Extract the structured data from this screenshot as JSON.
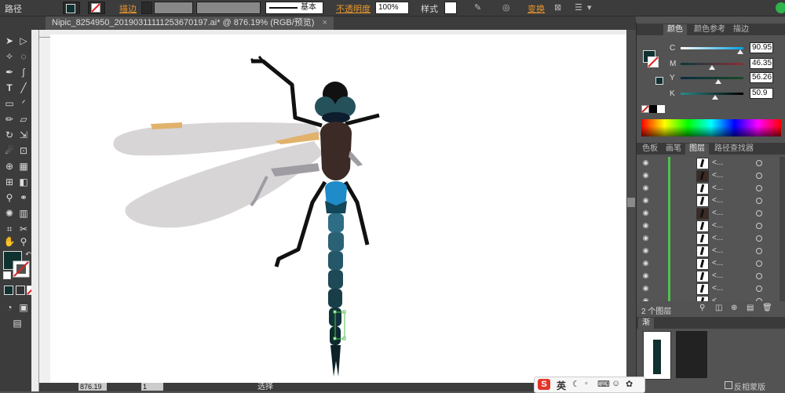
{
  "control_bar": {
    "object_type": "路径",
    "stroke_label": "描边",
    "brush_label": "基本",
    "opacity_label": "不透明度",
    "opacity_value": "100%",
    "style_label": "样式",
    "transform_label": "变换"
  },
  "document": {
    "tab_title": "Nipic_8254950_20190311111253670197.ai* @ 876.19% (RGB/预览)",
    "close_glyph": "×"
  },
  "colors": {
    "fill": "#0f3130",
    "stroke": "none",
    "accent_orange": "#e8962c",
    "layer_bar": "#4ec24e"
  },
  "color_panel": {
    "tabs": [
      "颜色",
      "颜色参考",
      "描边"
    ],
    "sliders": [
      {
        "label": "C",
        "value": "90.95"
      },
      {
        "label": "M",
        "value": "46.35"
      },
      {
        "label": "Y",
        "value": "56.26"
      },
      {
        "label": "K",
        "value": "50.9"
      }
    ]
  },
  "layers_panel": {
    "tabs": [
      "色板",
      "画笔",
      "图层",
      "路径查找器"
    ],
    "rows": [
      "<...",
      "<...",
      "<...",
      "<...",
      "<...",
      "<...",
      "<...",
      "<...",
      "<...",
      "<...",
      "<...",
      "<...",
      "<..."
    ],
    "footer_count": "2 个图层",
    "bottom_tab": "渐",
    "bottom_text": "反相蒙版"
  },
  "status_bar": {
    "zoom": "876.19",
    "page": "1",
    "mode": "选择"
  },
  "ime": {
    "lang": "英",
    "logo": "S"
  }
}
